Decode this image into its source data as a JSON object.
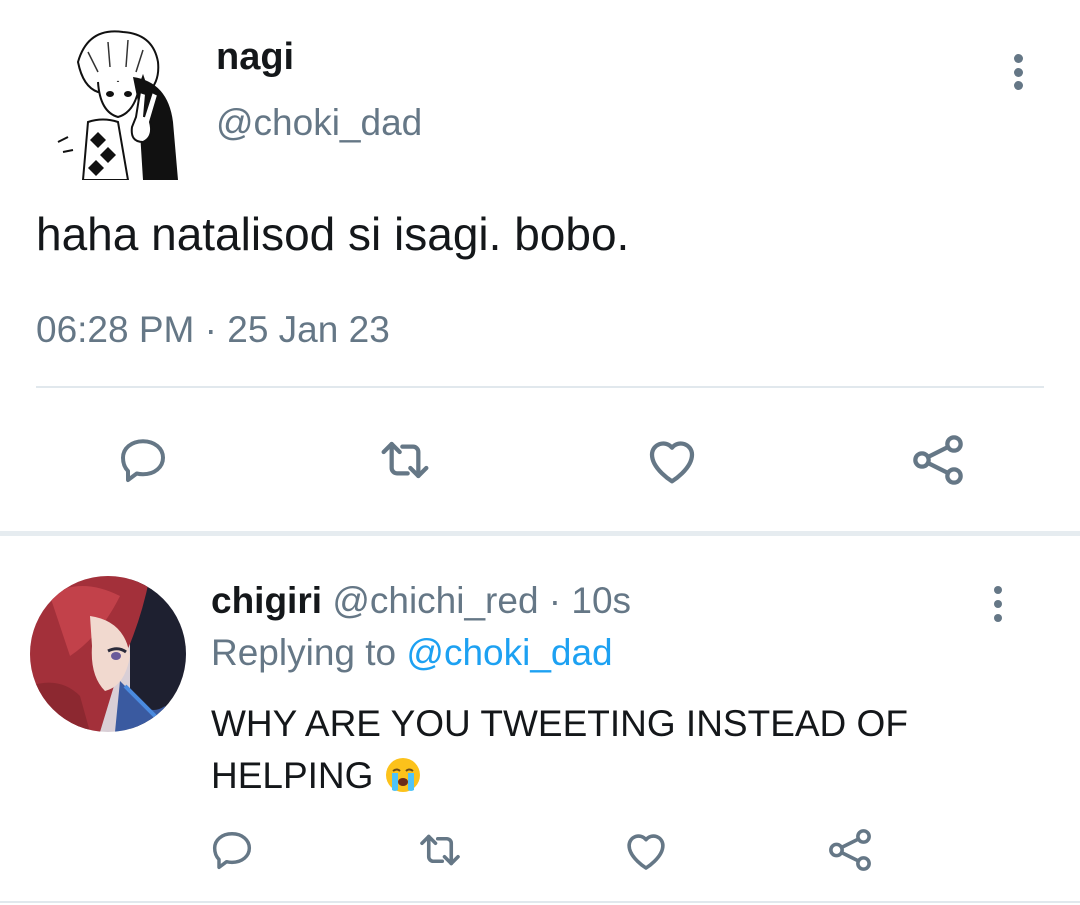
{
  "main_tweet": {
    "display_name": "nagi",
    "handle": "@choki_dad",
    "text": "haha natalisod si isagi. bobo.",
    "timestamp": "06:28 PM · 25 Jan 23",
    "actions": [
      "reply-icon",
      "retweet-icon",
      "like-icon",
      "share-icon"
    ]
  },
  "reply_tweet": {
    "display_name": "chigiri",
    "meta": "@chichi_red · 10s",
    "replying_prefix": "Replying to",
    "replying_handle": "@choki_dad",
    "text": "WHY ARE YOU TWEETING INSTEAD OF HELPING",
    "emoji": "loudly-crying-face",
    "actions": [
      "reply-icon",
      "retweet-icon",
      "like-icon",
      "share-icon"
    ]
  },
  "colors": {
    "text": "#14171a",
    "secondary": "#657786",
    "link": "#1da1f2",
    "divider": "#e1e8ed"
  }
}
